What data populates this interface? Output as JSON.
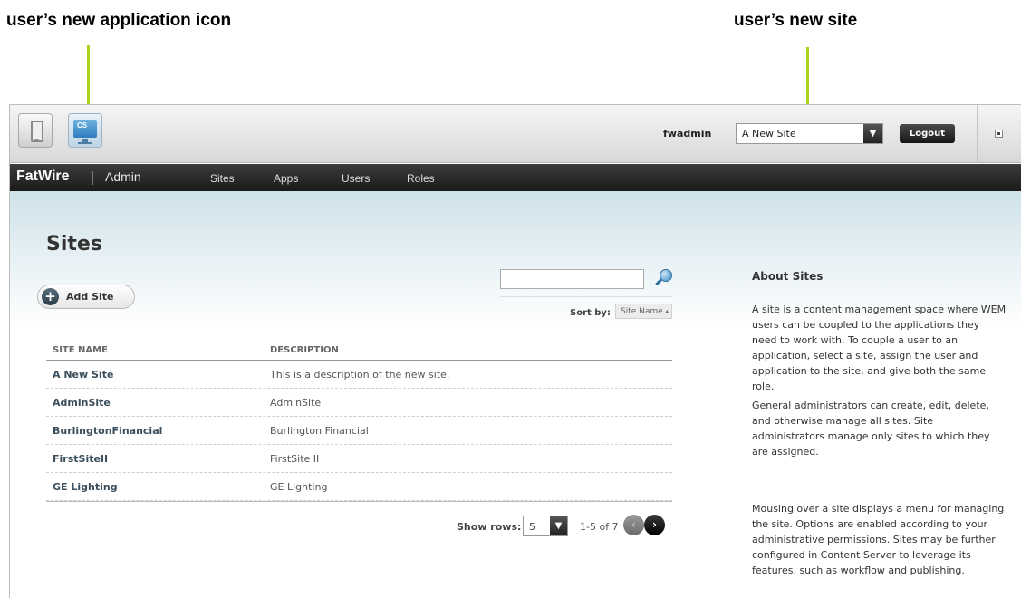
{
  "annotations": {
    "left": "user’s new application icon",
    "right": "user’s new site"
  },
  "topbar": {
    "username": "fwadmin",
    "site_select": "A New Site",
    "logout": "Logout",
    "cs_icon_text": "CS"
  },
  "nav": {
    "brand": "FatWire",
    "app": "Admin",
    "items": [
      "Sites",
      "Apps",
      "Users",
      "Roles"
    ]
  },
  "page": {
    "title": "Sites",
    "add_site": "Add Site",
    "search_placeholder": "",
    "sort_label": "Sort by:",
    "sort_value": "Site Name"
  },
  "table": {
    "headers": [
      "SITE NAME",
      "DESCRIPTION"
    ],
    "rows": [
      {
        "name": "A New Site",
        "description": "This is a description of the new site."
      },
      {
        "name": "AdminSite",
        "description": "AdminSite"
      },
      {
        "name": "BurlingtonFinancial",
        "description": "Burlington Financial"
      },
      {
        "name": "FirstSiteII",
        "description": "FirstSite II"
      },
      {
        "name": "GE Lighting",
        "description": "GE Lighting"
      }
    ]
  },
  "pagination": {
    "show_rows_label": "Show rows:",
    "rows_value": "5",
    "range": "1-5 of 7"
  },
  "about": {
    "title": "About Sites",
    "paragraphs": [
      "A site is a content management space where WEM users can be coupled to the applications they need to work with. To couple a user to an application, select a site, assign the user and application to the site, and give both the same role.",
      "General administrators can create, edit, delete, and otherwise manage all sites. Site administrators manage only sites to which they are assigned.",
      "Mousing over a site displays a menu for managing the site. Options are enabled according to your administrative permissions. Sites may be further configured in Content Server to leverage its features, such as workflow and publishing."
    ]
  },
  "colors": {
    "callout_line": "#a8d21c",
    "navbar": "#1a1a1a",
    "link_text": "#3a4e5c"
  }
}
